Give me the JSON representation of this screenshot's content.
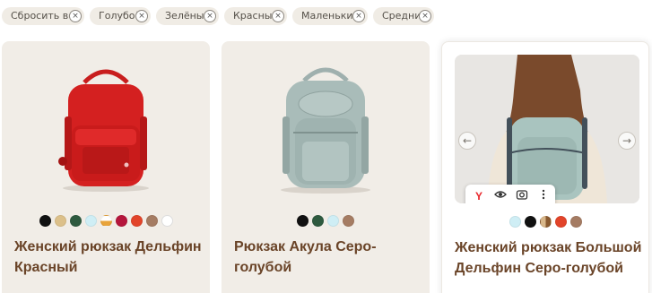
{
  "filters": {
    "chips": [
      {
        "label": "Сбросить все"
      },
      {
        "label": "Голубой"
      },
      {
        "label": "Зелёный"
      },
      {
        "label": "Красный"
      },
      {
        "label": "Маленький"
      },
      {
        "label": "Средний"
      }
    ],
    "remove_symbol": "×"
  },
  "products": [
    {
      "title": "Женский рюкзак Дельфин Красный",
      "swatches": [
        "#111111",
        "#dcc08a",
        "#2e5a3f",
        "#cfeef5",
        "#ffffff",
        "#b5163c",
        "#e2442a",
        "#a57c63",
        "#ffffff"
      ],
      "swatch_note": "5th swatch is split white/orange"
    },
    {
      "title": "Рюкзак Акула Серо-голубой",
      "swatches": [
        "#111111",
        "#2e5a3f",
        "#cfeef5",
        "#a57c63"
      ]
    },
    {
      "title": "Женский рюкзак Большой Дельфин Серо-голубой",
      "swatches": [
        "#cfeef5",
        "#111111",
        "#c9a06a",
        "#e2442a",
        "#a57c63"
      ],
      "gallery": {
        "prev_icon": "←",
        "next_icon": "→"
      },
      "image_toolbar": {
        "items": [
          "yandex-logo-icon",
          "eye-icon",
          "lens-search-icon",
          "more-vertical-icon"
        ],
        "logo_text": "Y"
      }
    }
  ],
  "colors": {
    "card_bg": "#f1ede7",
    "title": "#6a4428",
    "chip_bg": "#f0ece5"
  }
}
